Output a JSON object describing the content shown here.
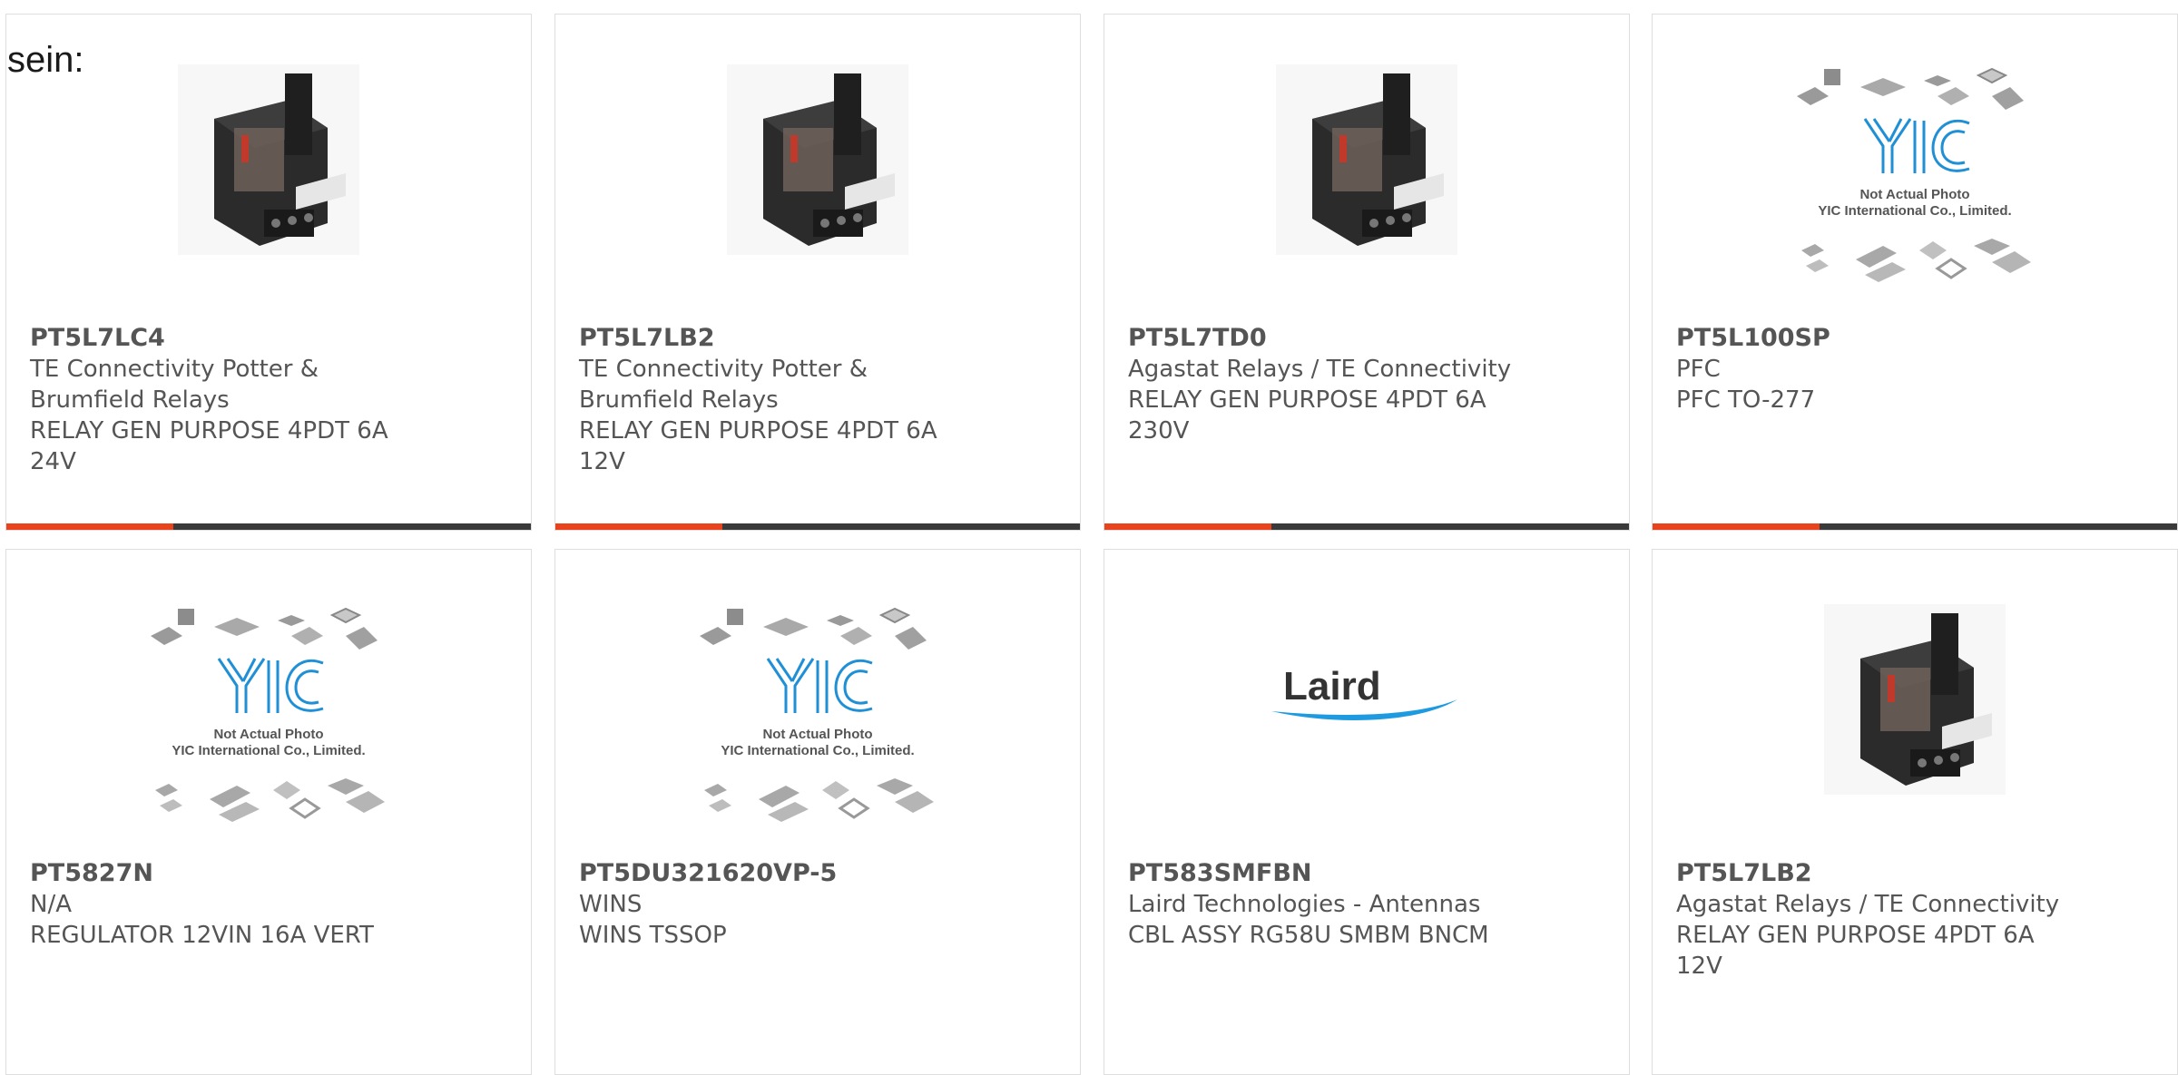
{
  "note": "sein:",
  "colors": {
    "accent": "#e8431c",
    "bar": "#3a3a3a",
    "text": "#555555",
    "placeholder_blue": "#1f8fd6"
  },
  "placeholder": {
    "logo": "YIC",
    "line1": "Not Actual Photo",
    "line2": "YIC International Co., Limited."
  },
  "laird_logo": "Laird",
  "products": [
    {
      "pn": "PT5L7LC4",
      "lines": [
        "TE Connectivity Potter &",
        "Brumfield Relays",
        "RELAY GEN PURPOSE 4PDT 6A",
        "24V"
      ],
      "image": "relay-photo"
    },
    {
      "pn": "PT5L7LB2",
      "lines": [
        "TE Connectivity Potter &",
        "Brumfield Relays",
        "RELAY GEN PURPOSE 4PDT 6A",
        "12V"
      ],
      "image": "relay-photo"
    },
    {
      "pn": "PT5L7TD0",
      "lines": [
        "Agastat Relays / TE Connectivity",
        "RELAY GEN PURPOSE 4PDT 6A",
        "230V"
      ],
      "image": "relay-photo"
    },
    {
      "pn": "PT5L100SP",
      "lines": [
        "PFC",
        "PFC TO-277"
      ],
      "image": "yic-placeholder"
    },
    {
      "pn": "PT5827N",
      "lines": [
        "N/A",
        "REGULATOR 12VIN 16A VERT"
      ],
      "image": "yic-placeholder"
    },
    {
      "pn": "PT5DU321620VP-5",
      "lines": [
        "WINS",
        "WINS TSSOP"
      ],
      "image": "yic-placeholder"
    },
    {
      "pn": "PT583SMFBN",
      "lines": [
        "Laird Technologies - Antennas",
        "CBL ASSY RG58U SMBM BNCM"
      ],
      "image": "laird-logo"
    },
    {
      "pn": "PT5L7LB2",
      "lines": [
        "Agastat Relays / TE Connectivity",
        "RELAY GEN PURPOSE 4PDT 6A",
        "12V"
      ],
      "image": "relay-photo"
    }
  ]
}
